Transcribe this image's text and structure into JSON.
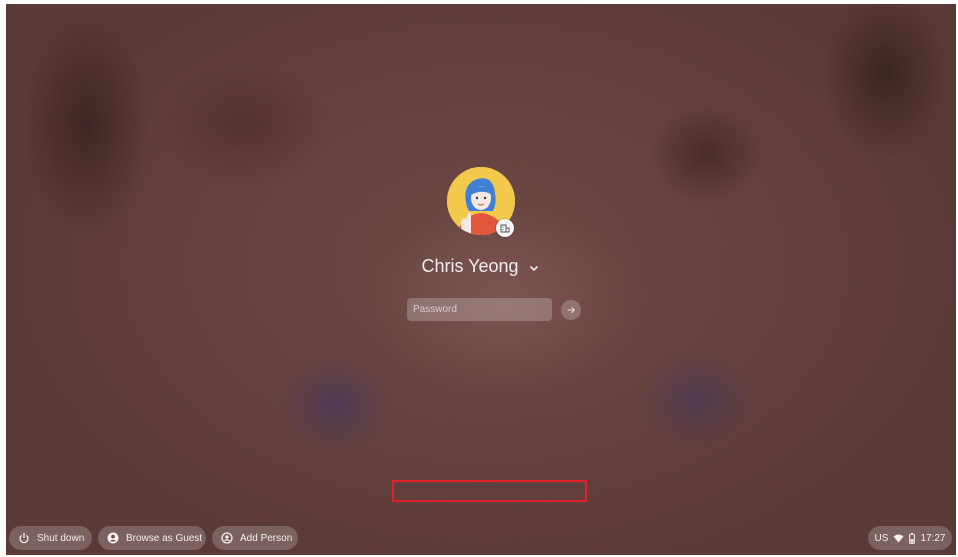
{
  "login": {
    "user_name": "Chris Yeong",
    "password_placeholder": "Password"
  },
  "shelf": {
    "shut_down_label": "Shut down",
    "browse_as_guest_label": "Browse as Guest",
    "add_person_label": "Add Person"
  },
  "status_tray": {
    "input_method": "US",
    "time": "17:27"
  },
  "icons": {
    "shut_down": "power-icon",
    "browse_as_guest": "guest-user-icon",
    "add_person": "add-person-icon",
    "expand_users": "chevron-down-icon",
    "submit": "arrow-right-icon",
    "avatar_badge": "enterprise-badge-icon",
    "network": "wifi-icon",
    "battery": "battery-icon"
  },
  "colors": {
    "wallpaper": "#5e3e3b",
    "avatar_background": "#f2c94c",
    "highlight_outline": "#e0202a"
  }
}
